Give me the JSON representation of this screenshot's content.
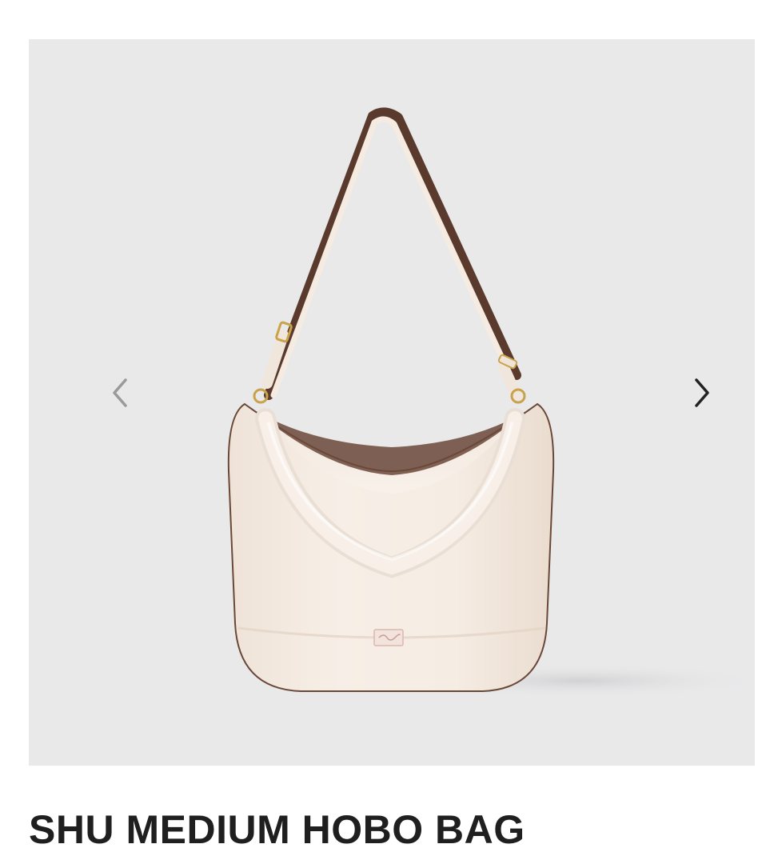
{
  "product": {
    "name": "SHU MEDIUM HOBO BAG",
    "image_alt": "Cream pebbled leather hobo bag with brown-edged shoulder strap"
  },
  "gallery": {
    "prev_icon": "chevron-left-icon",
    "next_icon": "chevron-right-icon",
    "prev_arrow_color": "#9a9a9a",
    "next_arrow_color": "#222222",
    "background_color": "#e9e9ea"
  },
  "colors": {
    "bag_body": "#f4ebe2",
    "strap_edge": "#5a3a2c",
    "hardware": "#c9a24a"
  }
}
